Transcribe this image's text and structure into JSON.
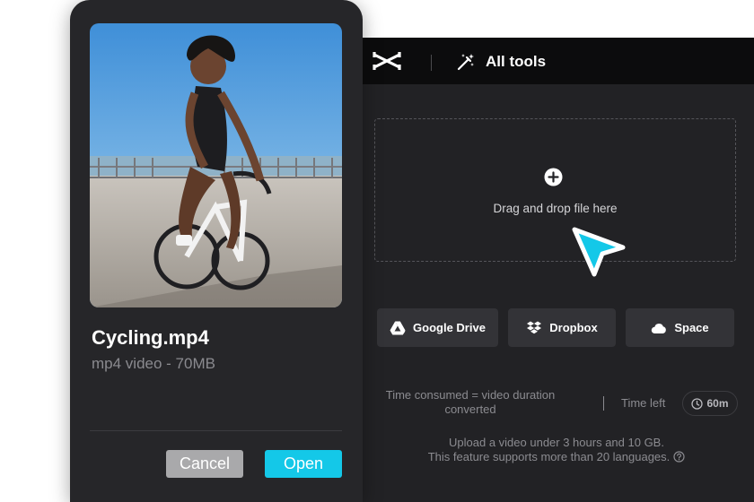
{
  "toolbar": {
    "logo_icon": "capcut-logo-icon",
    "tools_icon": "magic-wand-icon",
    "tools_label": "All tools"
  },
  "dropzone": {
    "icon": "plus-circle-icon",
    "label": "Drag and drop file here",
    "cursor_icon": "pointer-cursor-icon",
    "cursor_color": "#14c8e8"
  },
  "sources": [
    {
      "label": "Google Drive",
      "icon": "google-drive-icon"
    },
    {
      "label": "Dropbox",
      "icon": "dropbox-icon"
    },
    {
      "label": "Space",
      "icon": "cloud-icon"
    }
  ],
  "usage": {
    "consumed_line1": "Time consumed = video duration",
    "consumed_line2": "converted",
    "time_left_label": "Time left",
    "time_left_value": "60m",
    "time_icon": "clock-icon"
  },
  "notes": {
    "line1": "Upload a video under 3 hours and 10 GB.",
    "line2": "This feature supports more than 20 languages.",
    "help_icon": "help-circle-icon"
  },
  "file_card": {
    "thumbnail": "cycling-video-thumbnail",
    "name": "Cycling.mp4",
    "meta": "mp4 video - 70MB",
    "cancel_label": "Cancel",
    "open_label": "Open"
  },
  "colors": {
    "accent": "#14c8e8",
    "panel": "#222225",
    "card": "#262629"
  }
}
